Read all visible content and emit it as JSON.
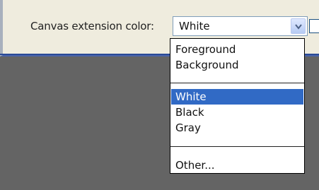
{
  "dialog": {
    "label": "Canvas extension color:",
    "combo_value": "White"
  },
  "dropdown": {
    "options": [
      "Foreground",
      "Background",
      "White",
      "Black",
      "Gray",
      "Other..."
    ],
    "selected": "White"
  },
  "colors": {
    "panel_bg": "#efecde",
    "workspace_bg": "#646464",
    "selection": "#316ac5"
  },
  "icons": {
    "combo_arrow": "chevron-down-icon"
  }
}
